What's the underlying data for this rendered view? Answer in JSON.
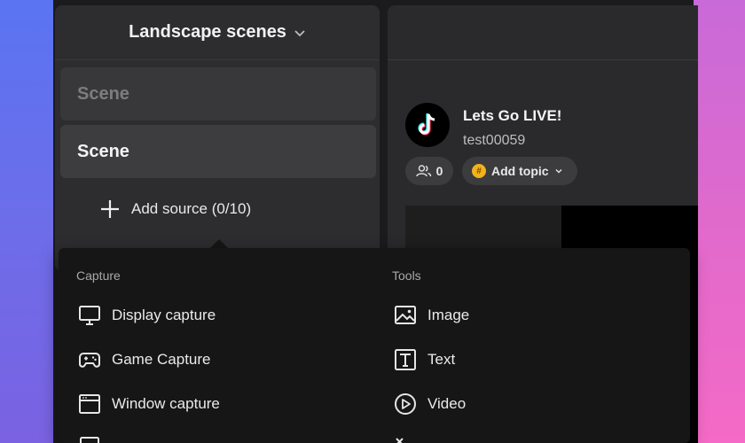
{
  "scenes": {
    "header_title": "Landscape scenes",
    "items": [
      {
        "label": "Scene"
      },
      {
        "label": "Scene"
      }
    ],
    "add_source_label": "Add source (0/10)"
  },
  "preview": {
    "title": "Lets Go LIVE!",
    "username": "test00059",
    "viewer_count": "0",
    "topic_label": "Add topic"
  },
  "menu": {
    "capture": {
      "title": "Capture",
      "items": [
        {
          "label": "Display capture",
          "icon": "monitor-icon"
        },
        {
          "label": "Game Capture",
          "icon": "gamepad-icon"
        },
        {
          "label": "Window capture",
          "icon": "window-icon"
        }
      ]
    },
    "tools": {
      "title": "Tools",
      "items": [
        {
          "label": "Image",
          "icon": "image-icon"
        },
        {
          "label": "Text",
          "icon": "text-icon"
        },
        {
          "label": "Video",
          "icon": "play-circle-icon"
        }
      ]
    }
  },
  "colors": {
    "panel": "#2d2d30",
    "menu": "#161617",
    "topic_badge": "#f2b21b"
  }
}
